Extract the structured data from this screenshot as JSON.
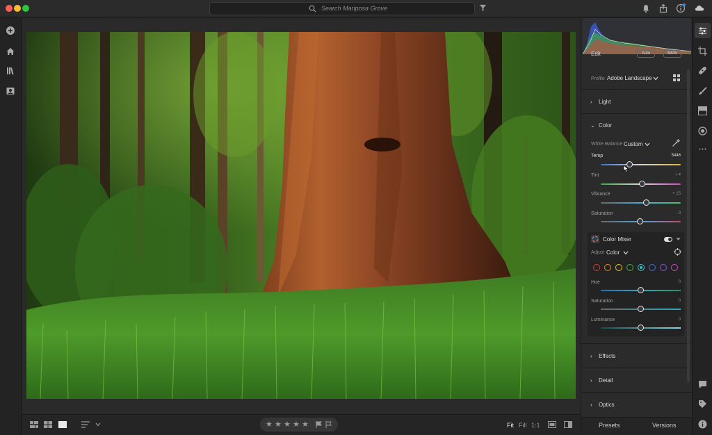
{
  "titlebar": {
    "search_placeholder": "Search Mariposa Grove"
  },
  "edit_panel": {
    "title": "Edit",
    "auto_label": "Auto",
    "bw_label": "B&W",
    "profile_label": "Profile",
    "profile_value": "Adobe Landscape",
    "sections": {
      "light": "Light",
      "color": "Color",
      "effects": "Effects",
      "detail": "Detail",
      "optics": "Optics"
    },
    "white_balance_label": "White Balance",
    "white_balance_value": "Custom",
    "sliders": [
      {
        "label": "Temp",
        "value": "5446",
        "position": 0.36
      },
      {
        "label": "Tint",
        "value": "+ 4",
        "position": 0.52
      },
      {
        "label": "Vibrance",
        "value": "+ 15",
        "position": 0.57
      },
      {
        "label": "Saturation",
        "value": "- 3",
        "position": 0.49
      }
    ],
    "color_mixer": {
      "title": "Color Mixer",
      "adjust_label": "Adjust",
      "adjust_value": "Color",
      "swatches": [
        "#d8392f",
        "#e98a1c",
        "#e3c51b",
        "#3eb24a",
        "#2fbfc7",
        "#3f6ee8",
        "#8f4fe0",
        "#d04cc6"
      ],
      "selected_swatch": 4,
      "sliders": [
        {
          "label": "Hue",
          "value": "0",
          "position": 0.5
        },
        {
          "label": "Saturation",
          "value": "0",
          "position": 0.5
        },
        {
          "label": "Luminance",
          "value": "0",
          "position": 0.5
        }
      ]
    }
  },
  "footer": {
    "presets": "Presets",
    "versions": "Versions"
  },
  "bottombar": {
    "fit": "Fit",
    "fill": "Fill",
    "one_to_one": "1:1",
    "rating": 0
  }
}
